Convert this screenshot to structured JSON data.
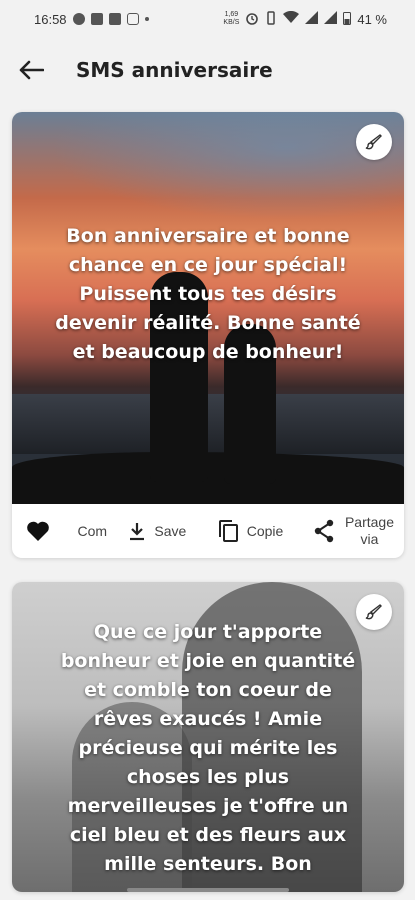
{
  "status_bar": {
    "time": "16:58",
    "speed": "1,69",
    "speed_unit": "KB/S",
    "battery": "41 %"
  },
  "app_bar": {
    "title": "SMS anniversaire",
    "back_icon": "arrow-left-icon"
  },
  "cards": [
    {
      "quote": "Bon anniversaire et bonne chance en ce jour spécial! Puissent tous tes désirs devenir réalité. Bonne santé et beaucoup de bonheur!",
      "edit_icon": "brush-icon",
      "actions": {
        "like_icon": "heart-icon",
        "comment_label": "Com",
        "save_label": "Save",
        "copy_label": "Copie",
        "share_label_line1": "Partage",
        "share_label_line2": "via"
      }
    },
    {
      "quote": "Que ce jour t'apporte bonheur et joie en quantité et comble ton coeur de rêves exaucés ! Amie précieuse qui mérite les choses les plus merveilleuses  je t'offre un ciel bleu et des fleurs aux mille senteurs. Bon",
      "edit_icon": "brush-icon"
    }
  ],
  "colors": {
    "background": "#f2f2f2",
    "card": "#ffffff",
    "text": "#222222"
  }
}
